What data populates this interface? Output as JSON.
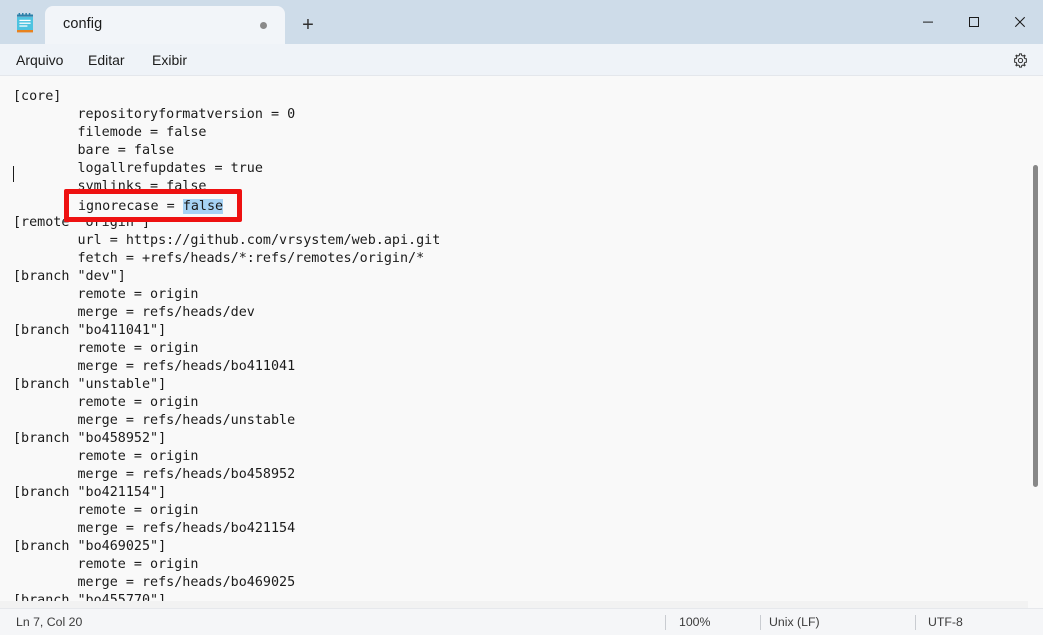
{
  "window": {
    "app_icon": "notepad-icon",
    "minimize_label": "Minimizar",
    "maximize_label": "Maximizar",
    "close_label": "Fechar"
  },
  "tabs": {
    "items": [
      {
        "label": "config",
        "modified": true
      }
    ],
    "new_tab_label": "+"
  },
  "menubar": {
    "items": [
      {
        "label": "Arquivo"
      },
      {
        "label": "Editar"
      },
      {
        "label": "Exibir"
      }
    ],
    "settings_icon": "gear-icon"
  },
  "editor": {
    "text_before_selection": "[core]\n        repositoryformatversion = 0\n        filemode = false\n        bare = false\n        logallrefupdates = true\n        symlinks = false\n        ignorecase = ",
    "selected_text": "false",
    "text_after_selection": "\n[remote \"origin\"]\n        url = https://github.com/vrsystem/web.api.git\n        fetch = +refs/heads/*:refs/remotes/origin/*\n[branch \"dev\"]\n        remote = origin\n        merge = refs/heads/dev\n[branch \"bo411041\"]\n        remote = origin\n        merge = refs/heads/bo411041\n[branch \"unstable\"]\n        remote = origin\n        merge = refs/heads/unstable\n[branch \"bo458952\"]\n        remote = origin\n        merge = refs/heads/bo458952\n[branch \"bo421154\"]\n        remote = origin\n        merge = refs/heads/bo421154\n[branch \"bo469025\"]\n        remote = origin\n        merge = refs/heads/bo469025\n[branch \"bo455770\"]",
    "selection_color": "#a6d2f4"
  },
  "annotation": {
    "highlighted_line_prefix": "ignorecase = ",
    "highlighted_line_value": "false",
    "box_color": "#ee1111"
  },
  "statusbar": {
    "cursor_position": "Ln 7, Col 20",
    "zoom": "100%",
    "line_ending": "Unix (LF)",
    "encoding": "UTF-8"
  }
}
